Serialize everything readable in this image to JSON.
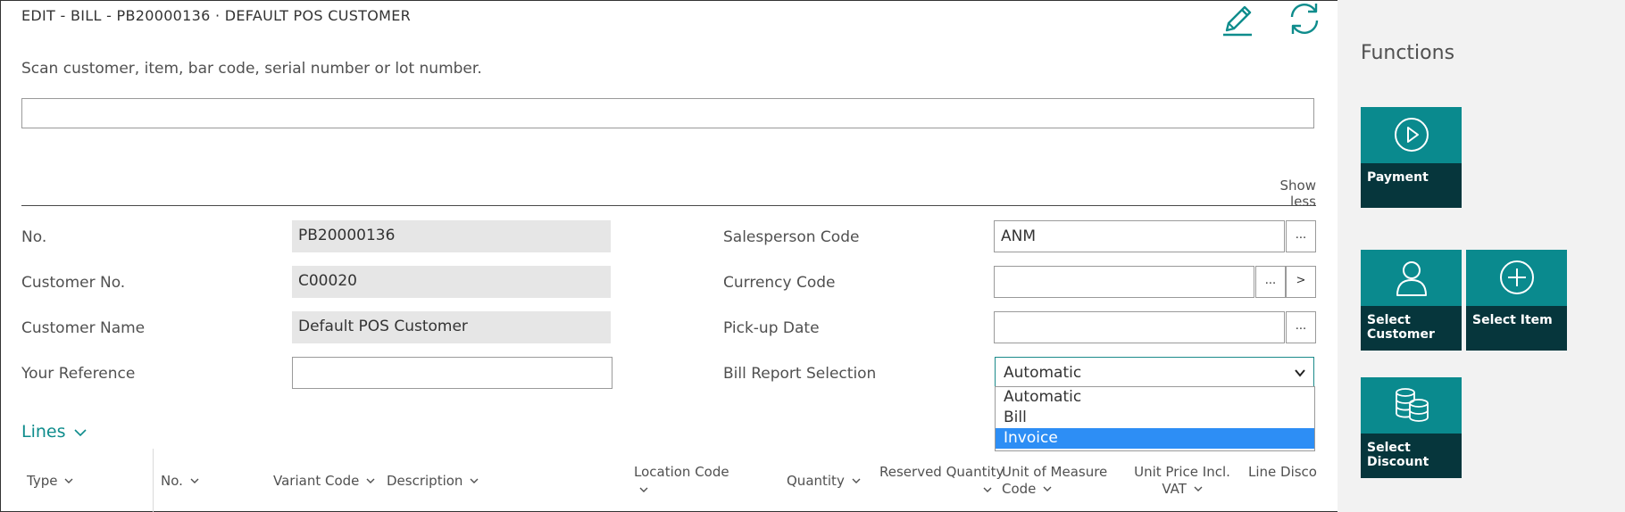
{
  "page": {
    "title": "EDIT - BILL - PB20000136 · DEFAULT POS CUSTOMER",
    "scan_hint": "Scan customer, item, bar code, serial number or lot number.",
    "scan_value": "",
    "show_less": "Show less"
  },
  "toolbar": {
    "edit_icon": "pencil-icon",
    "refresh_icon": "refresh-icon"
  },
  "fields": {
    "no": {
      "label": "No.",
      "value": "PB20000136"
    },
    "customer_no": {
      "label": "Customer No.",
      "value": "C00020"
    },
    "customer_name": {
      "label": "Customer Name",
      "value": "Default POS Customer"
    },
    "your_reference": {
      "label": "Your Reference",
      "value": ""
    },
    "salesperson_code": {
      "label": "Salesperson Code",
      "value": "ANM",
      "lookup": "..."
    },
    "currency_code": {
      "label": "Currency Code",
      "value": "",
      "lookup": "...",
      "drill": ">"
    },
    "pickup_date": {
      "label": "Pick-up Date",
      "value": "",
      "lookup": "..."
    },
    "bill_report_selection": {
      "label": "Bill Report Selection",
      "value": "Automatic",
      "options": [
        "Automatic",
        "Bill",
        "Invoice"
      ],
      "highlighted": "Invoice"
    }
  },
  "lines": {
    "title": "Lines",
    "columns": [
      "Type",
      "No.",
      "Variant Code",
      "Description",
      "Location Code",
      "Quantity",
      "Reserved Quantity",
      "Unit of Measure Code",
      "Unit Price Incl. VAT",
      "Line Discou"
    ]
  },
  "functions": {
    "title": "Functions",
    "tiles": [
      {
        "label": "Payment",
        "icon": "play-circle-icon"
      },
      {
        "label": "Select Customer",
        "icon": "person-icon"
      },
      {
        "label": "Select Item",
        "icon": "plus-circle-icon"
      },
      {
        "label": "Select Discount",
        "icon": "coins-icon"
      }
    ]
  },
  "colors": {
    "accent": "#0e8c8c",
    "tile_top": "#0a8a8e",
    "tile_bottom": "#06363c",
    "dropdown_highlight": "#2d8ef5",
    "readonly_bg": "#e6e6e6",
    "side_panel_bg": "#f2f2f2"
  }
}
